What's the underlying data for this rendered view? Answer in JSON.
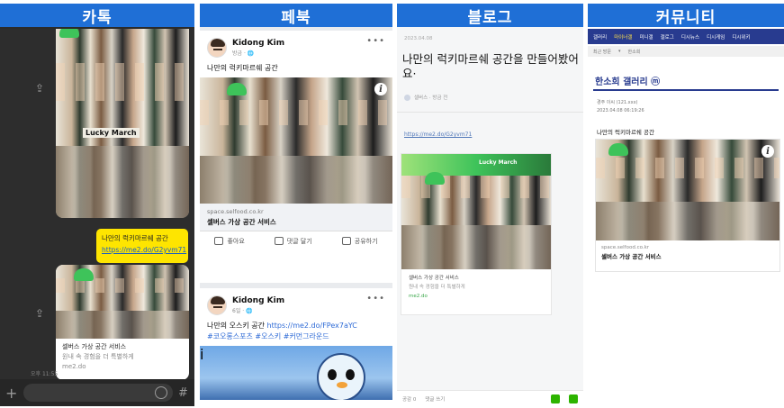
{
  "panels": {
    "kakao": {
      "title": "카톡",
      "message_text": "나만의 럭키마르쉐 공간",
      "message_link": "https://me2.do/G2yvm71",
      "card_title": "셀버스 가상 공간 서비스",
      "card_desc": "원내 속 경험을 더 특별하게",
      "card_source": "me2.do",
      "time": "오후 11:55",
      "share_icon": "share-icon",
      "photo_text": "Lucky March"
    },
    "facebook": {
      "title": "페북",
      "posts": [
        {
          "author": "Kidong Kim",
          "time": "방금 · 🌐",
          "text": "나만의 럭키마르쉐 공간",
          "link_domain": "space.selfood.co.kr",
          "link_title": "셀버스 가상 공간 서비스"
        },
        {
          "author": "Kidong Kim",
          "time": "6일 · 🌐",
          "text_prefix": "나만의 오스키 공간 ",
          "text_link": "https://me2.do/FPex7aYC",
          "hashtags": "#코오롱스포츠 #오스키 #커먼그라운드"
        }
      ],
      "actions": {
        "like": "좋아요",
        "comment": "댓글 달기",
        "share": "공유하기"
      },
      "more": "•••"
    },
    "blog": {
      "title": "블로그",
      "date": "2023.04.08",
      "post_title": "나만의 럭키마르쉐 공간을 만들어봤어요·",
      "author": "셀버스 · 방금 전",
      "link": "https://me2.do/G2yvm71",
      "card_title": "셀버스 가상 공간 서비스",
      "card_desc": "원내 속 경험을 더 특별하게",
      "card_source": "me2.do",
      "bottom_like": "공감 0",
      "bottom_comment": "댓글 쓰기",
      "photo_text": "Lucky March"
    },
    "community": {
      "title": "커뮤니티",
      "nav": [
        "갤러리",
        "마이너갤",
        "미니갤",
        "갤로그",
        "디시뉴스",
        "디시게임",
        "디시위키"
      ],
      "nav_highlight_index": 1,
      "sub_nav": [
        "최근 방문",
        "▾",
        "한소희"
      ],
      "gallery_title": "한소희 갤러리 ⓜ",
      "post_author": "경주 이씨",
      "post_ip": "(121.xxx)",
      "post_date": "2023.04.08 06:19:26",
      "post_text": "나만의 럭키마르쉐 공간",
      "card_domain": "space.selfood.co.kr",
      "card_title": "셀버스 가상 공간 서비스"
    }
  },
  "colors": {
    "header_blue": "#1f6fd6",
    "kakao_yellow": "#fee500",
    "fb_link_blue": "#2d6ad6",
    "dc_navy": "#283b8f",
    "naver_green": "#2db400"
  }
}
